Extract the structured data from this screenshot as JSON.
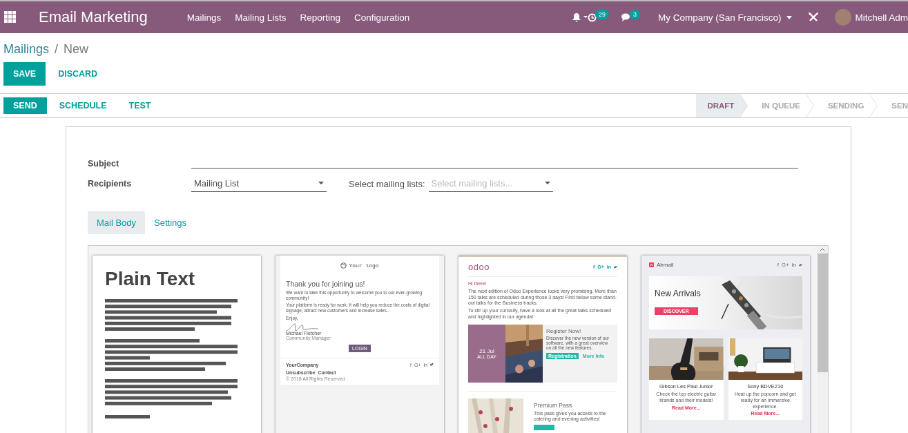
{
  "navbar": {
    "app_title": "Email Marketing",
    "menu": [
      "Mailings",
      "Mailing Lists",
      "Reporting",
      "Configuration"
    ],
    "activity_count": "29",
    "message_count": "3",
    "company": "My Company (San Francisco)",
    "user": "Mitchell Adm"
  },
  "breadcrumb": {
    "parent": "Mailings",
    "separator": "/",
    "current": "New"
  },
  "form_buttons": [
    "SAVE",
    "DISCARD"
  ],
  "actions": [
    {
      "label": "SEND",
      "primary": true
    },
    {
      "label": "SCHEDULE",
      "primary": false
    },
    {
      "label": "TEST",
      "primary": false
    }
  ],
  "stages": [
    {
      "label": "DRAFT",
      "selected": true
    },
    {
      "label": "IN QUEUE",
      "selected": false
    },
    {
      "label": "SENDING",
      "selected": false
    },
    {
      "label": "SEN",
      "selected": false
    }
  ],
  "fields": {
    "subject_label": "Subject",
    "recipients_label": "Recipients",
    "recipients_value": "Mailing List",
    "lists_label": "Select mailing lists:",
    "lists_placeholder": "Select mailing lists..."
  },
  "tabs": [
    {
      "label": "Mail Body",
      "selected": true
    },
    {
      "label": "Settings",
      "selected": false
    }
  ],
  "templates": [
    {
      "kind": "plain",
      "title": "Plain Text"
    },
    {
      "kind": "welcome",
      "logo": "Your logo",
      "heading": "Thank you for joining us!",
      "paragraphs": [
        "We want to take this opportunity to welcome you to our ever-growing community!",
        "Your platform is ready for work. It will help you reduce the costs of digital signage, attract new customers and increase sales.",
        "Enjoy,"
      ],
      "signer": "Michael Fletcher",
      "role": "Community Manager",
      "button": "LOGIN",
      "company": "YourCompany",
      "links": [
        "Unsubscribe",
        "Contact"
      ],
      "copyright": "© 2018 All Rights Reserved",
      "social": [
        "f",
        "G+",
        "in"
      ]
    },
    {
      "kind": "event",
      "logo": "odoo",
      "social": [
        "f",
        "G+",
        "in"
      ],
      "paragraphs": [
        "Hi there!",
        "The next edition of Odoo Experience looks very promising. More than 150 talks are scheduled during those 3 days! Find below some stand-out talks for the Business tracks.",
        "To stir up your curiosity, have a look at all the great talks scheduled and highlighted in our agenda!"
      ],
      "date": "21 Jul",
      "date_note": "ALL DAY",
      "event_title": "Register Now!",
      "event_text": "Discover the new version of our software, with a great overview on all the new features.",
      "primary_button": "Registration",
      "secondary_link": "More Info",
      "pass_title": "Premium Pass",
      "pass_text": "This pass gives you access to the catering and evening activities!"
    },
    {
      "kind": "store",
      "brand": "Airmail",
      "social": [
        "f",
        "G+",
        "in"
      ],
      "hero_title": "New Arrivals",
      "hero_button": "DISCOVER",
      "products": [
        {
          "name": "Gibson Les Paul Junior",
          "text": "Check the top electric guitar brands and their models!",
          "link": "Read More..."
        },
        {
          "name": "Sony BDVE210",
          "text": "Heat up the popcorn and get ready for an immersive experience.",
          "link": "Read More..."
        }
      ]
    }
  ]
}
